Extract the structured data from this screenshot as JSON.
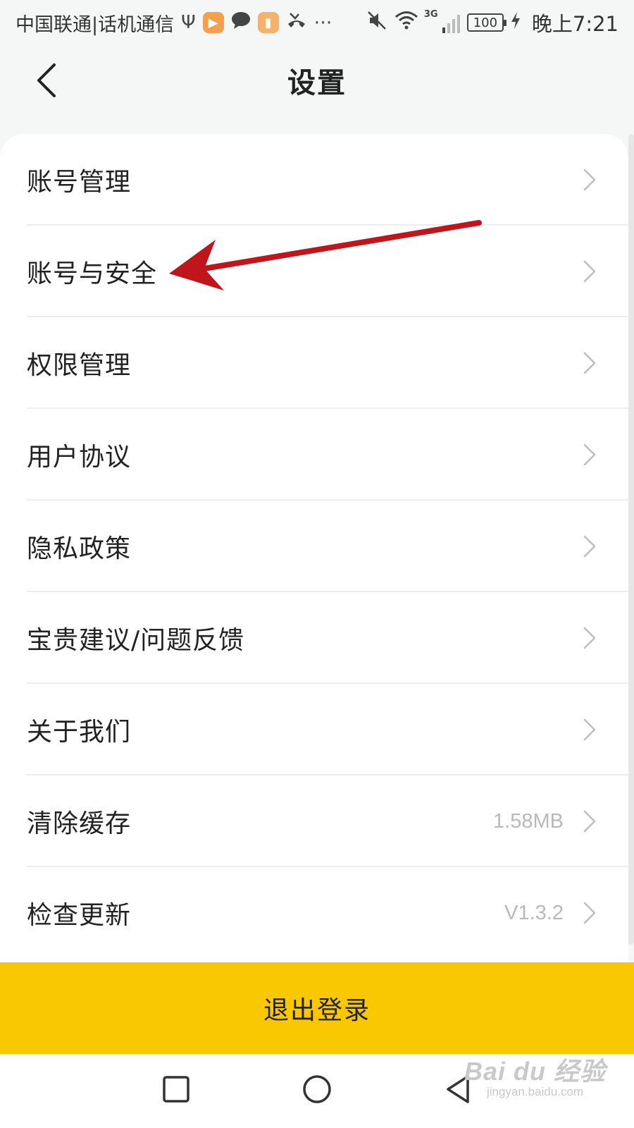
{
  "status_bar": {
    "carrier": "中国联通|话机通信",
    "network_label": "3G",
    "battery": "100",
    "time": "晚上7:21",
    "icons": [
      "usb-icon",
      "video-app-icon",
      "message-icon",
      "note-app-icon",
      "missed-call-icon",
      "more-icon",
      "mute-icon",
      "wifi-icon",
      "signal-icon",
      "charging-icon"
    ]
  },
  "header": {
    "title": "设置",
    "back_icon": "chevron-left-icon"
  },
  "settings": {
    "items": [
      {
        "label": "账号管理",
        "value": ""
      },
      {
        "label": "账号与安全",
        "value": ""
      },
      {
        "label": "权限管理",
        "value": ""
      },
      {
        "label": "用户协议",
        "value": ""
      },
      {
        "label": "隐私政策",
        "value": ""
      },
      {
        "label": "宝贵建议/问题反馈",
        "value": ""
      },
      {
        "label": "关于我们",
        "value": ""
      },
      {
        "label": "清除缓存",
        "value": "1.58MB"
      },
      {
        "label": "检查更新",
        "value": "V1.3.2"
      }
    ]
  },
  "logout": {
    "label": "退出登录"
  },
  "watermark": {
    "main": "Bai du 经验",
    "sub": "jingyan.baidu.com"
  },
  "colors": {
    "accent": "#f9c801",
    "background": "#f5f6f6",
    "card": "#ffffff",
    "annotation_arrow": "#c0161b",
    "secondary_text": "#b9b9b9"
  }
}
